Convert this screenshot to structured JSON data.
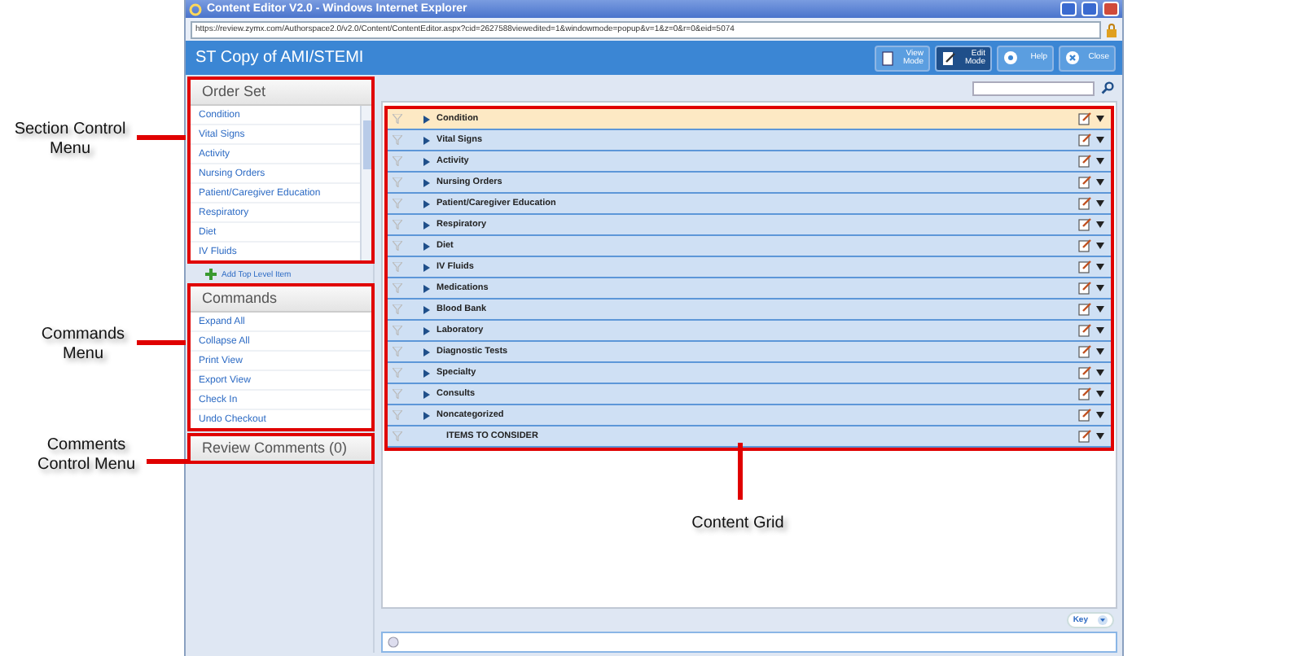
{
  "window": {
    "title": "Content Editor V2.0 - Windows Internet Explorer",
    "url": "https://review.zymx.com/Authorspace2.0/v2.0/Content/ContentEditor.aspx?cid=2627588viewedited=1&windowmode=popup&v=1&z=0&r=0&eid=5074"
  },
  "app": {
    "title": "ST Copy of AMI/STEMI",
    "buttons": [
      {
        "label": "View Mode",
        "kind": "view",
        "selected": false
      },
      {
        "label": "Edit Mode",
        "kind": "edit",
        "selected": true
      },
      {
        "label": "Help",
        "kind": "help",
        "selected": false
      },
      {
        "label": "Close",
        "kind": "close",
        "selected": false
      }
    ]
  },
  "order_set": {
    "title": "Order Set",
    "items": [
      "Condition",
      "Vital Signs",
      "Activity",
      "Nursing Orders",
      "Patient/Caregiver Education",
      "Respiratory",
      "Diet",
      "IV Fluids"
    ],
    "add_label": "Add Top Level Item"
  },
  "commands": {
    "title": "Commands",
    "items": [
      "Expand All",
      "Collapse All",
      "Print View",
      "Export View",
      "Check In",
      "Undo Checkout"
    ]
  },
  "review_comments": {
    "title": "Review Comments (0)"
  },
  "grid": {
    "rows": [
      {
        "label": "Condition",
        "selected": true,
        "expandable": true
      },
      {
        "label": "Vital Signs",
        "selected": false,
        "expandable": true
      },
      {
        "label": "Activity",
        "selected": false,
        "expandable": true
      },
      {
        "label": "Nursing Orders",
        "selected": false,
        "expandable": true
      },
      {
        "label": "Patient/Caregiver Education",
        "selected": false,
        "expandable": true
      },
      {
        "label": "Respiratory",
        "selected": false,
        "expandable": true
      },
      {
        "label": "Diet",
        "selected": false,
        "expandable": true
      },
      {
        "label": "IV Fluids",
        "selected": false,
        "expandable": true
      },
      {
        "label": "Medications",
        "selected": false,
        "expandable": true
      },
      {
        "label": "Blood Bank",
        "selected": false,
        "expandable": true
      },
      {
        "label": "Laboratory",
        "selected": false,
        "expandable": true
      },
      {
        "label": "Diagnostic Tests",
        "selected": false,
        "expandable": true
      },
      {
        "label": "Specialty",
        "selected": false,
        "expandable": true
      },
      {
        "label": "Consults",
        "selected": false,
        "expandable": true
      },
      {
        "label": "Noncategorized",
        "selected": false,
        "expandable": true
      },
      {
        "label": "ITEMS TO CONSIDER",
        "selected": false,
        "expandable": false
      }
    ]
  },
  "key_button": {
    "label": "Key"
  },
  "callouts": {
    "order_set": "Section Control Menu",
    "commands": "Commands Menu",
    "review_comments": "Comments Control Menu",
    "grid": "Content Grid"
  }
}
